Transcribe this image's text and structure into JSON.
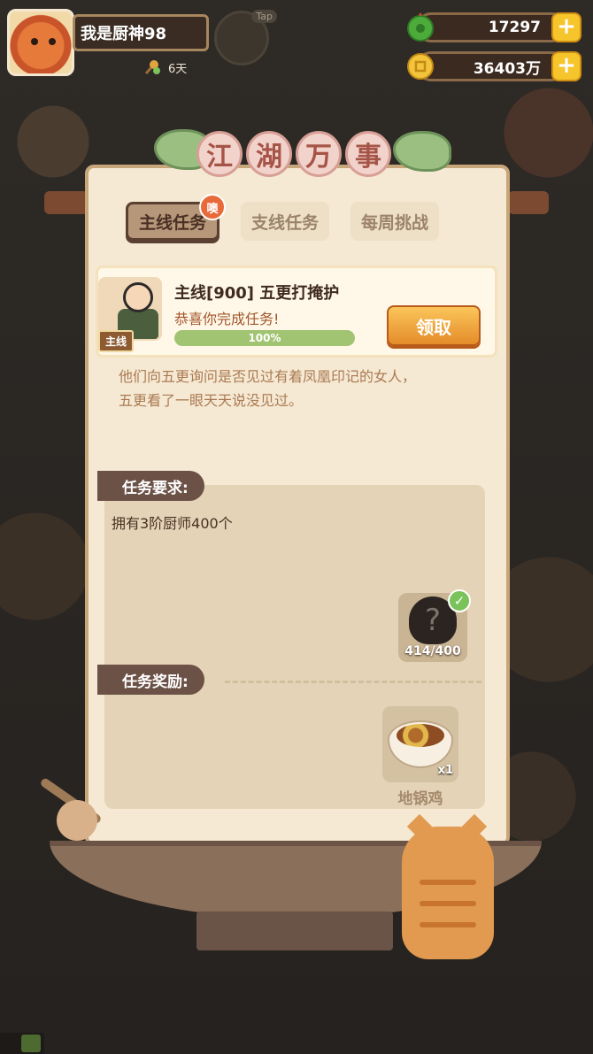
{
  "player": {
    "name": "我是厨神98",
    "days": "6天",
    "tap_label": "Tap"
  },
  "resources": {
    "jade": "17297",
    "coins": "36403万"
  },
  "panel": {
    "title_chars": [
      "江",
      "湖",
      "万",
      "事"
    ],
    "tabs": [
      {
        "label": "主线任务",
        "active": true,
        "badge": "噢"
      },
      {
        "label": "支线任务",
        "active": false
      },
      {
        "label": "每周挑战",
        "active": false
      }
    ],
    "task": {
      "tag": "主线",
      "title": "主线[900] 五更打掩护",
      "status": "恭喜你完成任务!",
      "progress_text": "100%",
      "progress": 1.0,
      "claim_label": "领取"
    },
    "story_lines": [
      "他们向五更询问是否见过有着凤凰印记的女人，",
      "五更看了一眼天天说没见过。"
    ],
    "requirement": {
      "heading": "任务要求:",
      "text": "拥有3阶厨师400个",
      "count": "414/400",
      "unknown_mark": "?"
    },
    "reward": {
      "heading": "任务奖励:",
      "item_name": "地锅鸡",
      "quantity": "x1"
    }
  },
  "colors": {
    "claim_button": "#e48c2a",
    "progress_fill": "#a1c472",
    "tab_active_bg": "#b7977a",
    "panel_bg": "#f5e9d4"
  },
  "icons": [
    "jade-coin-icon",
    "gold-coin-icon",
    "plus-icon",
    "check-icon",
    "fan-sprout-icon"
  ]
}
